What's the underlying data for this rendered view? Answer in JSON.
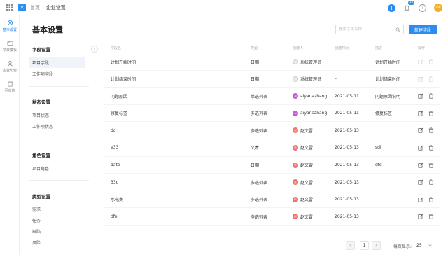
{
  "topbar": {
    "breadcrumb_home": "首页",
    "breadcrumb_sep": "›",
    "breadcrumb_current": "企业设置",
    "notify_count": "16",
    "user_initials": "SW"
  },
  "leftnav": [
    {
      "label": "基本设置",
      "icon": "gear-icon"
    },
    {
      "label": "项目模板",
      "icon": "folder-icon"
    },
    {
      "label": "企业角色",
      "icon": "user-icon"
    },
    {
      "label": "回收站",
      "icon": "trash-icon"
    }
  ],
  "page": {
    "title": "基本设置",
    "search_placeholder": "搜索字段名称",
    "new_button": "新建字段"
  },
  "sidemenu": {
    "groups": [
      {
        "title": "字段设置",
        "items": [
          "项目字段",
          "工作项字段"
        ]
      },
      {
        "title": "状态设置",
        "items": [
          "项目状态",
          "工作项状态"
        ]
      },
      {
        "title": "角色设置",
        "items": [
          "项目角色"
        ]
      },
      {
        "title": "类型设置",
        "items": [
          "需求",
          "任务",
          "缺陷",
          "风险"
        ]
      }
    ],
    "active_item": "项目字段"
  },
  "table": {
    "headers": [
      "字段名",
      "类型",
      "创建人",
      "创建时间",
      "描述",
      "操作"
    ],
    "rows": [
      {
        "name": "计划开始时间",
        "type": "日期",
        "creator": "系统管理员",
        "avatar": "sys",
        "time": "--",
        "desc": "计划开始时间",
        "editable": false
      },
      {
        "name": "计划结束时间",
        "type": "日期",
        "creator": "系统管理员",
        "avatar": "sys",
        "time": "--",
        "desc": "计划结束时间",
        "editable": false
      },
      {
        "name": "问题原因",
        "type": "单选列表",
        "creator": "aiyanazhang",
        "avatar": "ai",
        "time": "2021-05-11",
        "desc": "问题原因说明",
        "editable": true
      },
      {
        "name": "修复标签",
        "type": "多选列表",
        "creator": "aiyanazhang",
        "avatar": "ai",
        "time": "2021-05-11",
        "desc": "修复标签",
        "editable": true
      },
      {
        "name": "dd",
        "type": "多选列表",
        "creator": "赵文雷",
        "avatar": "zh",
        "time": "2021-05-13",
        "desc": "",
        "editable": true
      },
      {
        "name": "e33",
        "type": "文本",
        "creator": "赵文雷",
        "avatar": "zh",
        "time": "2021-05-13",
        "desc": "sdf",
        "editable": true
      },
      {
        "name": "date",
        "type": "日期",
        "creator": "赵文雷",
        "avatar": "zh",
        "time": "2021-05-13",
        "desc": "dfd",
        "editable": true
      },
      {
        "name": "33d",
        "type": "多选列表",
        "creator": "赵文雷",
        "avatar": "zh",
        "time": "2021-05-13",
        "desc": "",
        "editable": true
      },
      {
        "name": "水电费",
        "type": "多选列表",
        "creator": "赵文雷",
        "avatar": "zh",
        "time": "2021-05-13",
        "desc": "",
        "editable": true
      },
      {
        "name": "dfe",
        "type": "多选列表",
        "creator": "赵文雷",
        "avatar": "zh",
        "time": "2021-05-13",
        "desc": "",
        "editable": true
      }
    ]
  },
  "pager": {
    "prev": "‹",
    "current_page": "1",
    "next": "›",
    "size_label": "每页显示:",
    "page_size": "25"
  }
}
